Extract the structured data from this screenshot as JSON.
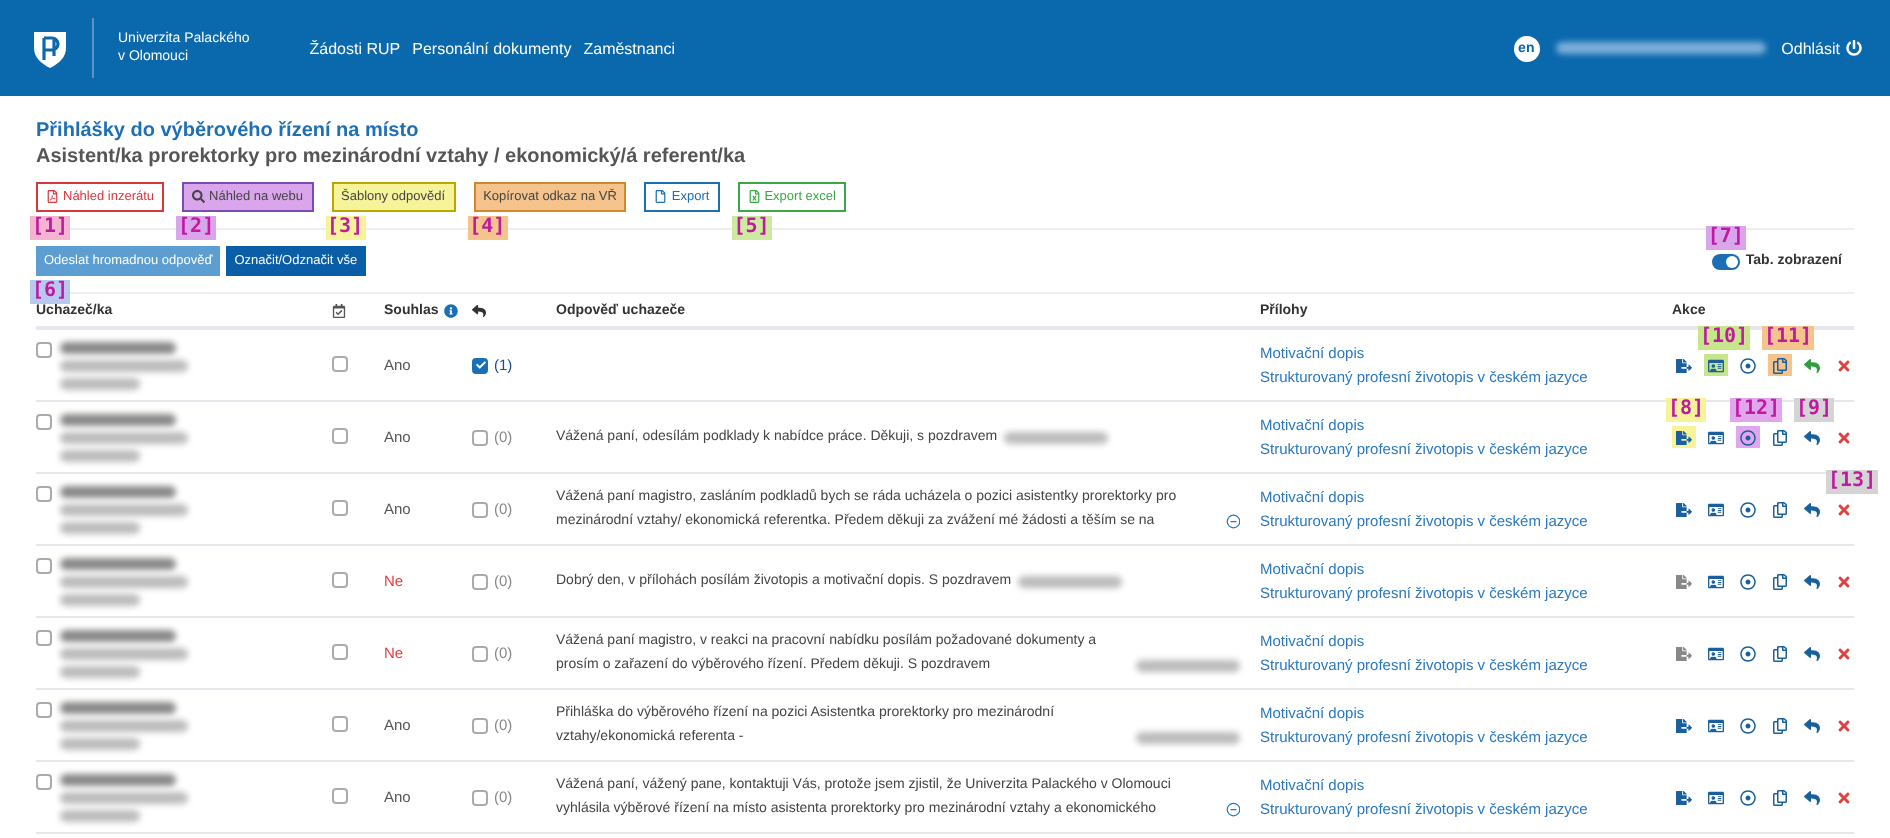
{
  "header": {
    "university": [
      "Univerzita Palackého",
      "v Olomouci"
    ],
    "nav": [
      "Žádosti RUP",
      "Personální dokumenty",
      "Zaměstnanci"
    ],
    "language": "en",
    "logout": "Odhlásit"
  },
  "title": "Přihlášky do výběrového řízení na místo",
  "subtitle": "Asistent/ka prorektorky pro mezinárodní vztahy / ekonomický/á referent/ka",
  "toolbar": [
    {
      "label": "Náhled inzerátu",
      "kind": "pdf",
      "color": "#d9363e",
      "callout": {
        "text": "[1]",
        "color": "#f3b5d0"
      }
    },
    {
      "label": "Náhled na webu",
      "kind": "search",
      "color": "#7b4bb5",
      "highlighted": true,
      "callout": {
        "text": "[2]",
        "color": "#d9a6ec"
      }
    },
    {
      "label": "Šablony odpovědí",
      "kind": "plain",
      "color": "#b9a800",
      "highlighted": true,
      "callout": {
        "text": "[3]",
        "color": "#f6f39a"
      }
    },
    {
      "label": "Kopírovat odkaz na VŘ",
      "kind": "plain",
      "color": "#d08a2c",
      "highlighted": true,
      "callout": {
        "text": "[4]",
        "color": "#f5c48c"
      }
    },
    {
      "label": "Export",
      "kind": "doc",
      "color": "#1a6fb5"
    },
    {
      "label": "Export excel",
      "kind": "excel",
      "color": "#3aa845",
      "callout": {
        "text": "[5]",
        "color": "#cdeaa0"
      }
    }
  ],
  "bulk": [
    {
      "label": "Odeslat hromadnou odpověď",
      "highlighted": true,
      "callout": {
        "text": "[6]",
        "color": "#b8c9f0"
      }
    },
    {
      "label": "Označit/Odznačit vše"
    }
  ],
  "toggle": {
    "label": "Tab. zobrazení",
    "on": true,
    "callout": {
      "text": "[7]",
      "color": "#d9a6ec"
    }
  },
  "columns": [
    "Uchazeč/ka",
    "Souhlas",
    "Odpověď uchazeče",
    "Přílohy",
    "Akce"
  ],
  "rows": [
    {
      "selected": false,
      "calendar": false,
      "consent": "Ano",
      "consent_ok": true,
      "replied": true,
      "count": "(1)",
      "actions": [
        {
          "kind": "export"
        },
        {
          "kind": "card",
          "highlighted": true,
          "callout": {
            "text": "[10]",
            "color": "#c7e58a"
          }
        },
        {
          "kind": "target"
        },
        {
          "kind": "copy",
          "highlighted": true,
          "callout": {
            "text": "[11]",
            "color": "#f5c48c"
          }
        },
        {
          "kind": "reply",
          "active": true
        },
        {
          "kind": "delete"
        }
      ],
      "attachments": [
        "Motivační dopis",
        "Strukturovaný profesní životopis v českém jazyce"
      ]
    },
    {
      "selected": false,
      "calendar": false,
      "consent": "Ano",
      "consent_ok": true,
      "replied": false,
      "count": "(0)",
      "response": "Vážená paní, odesílám podklady k nabídce práce. Děkuji, s pozdravem",
      "signature_redacted": true,
      "actions": [
        {
          "kind": "export",
          "highlighted": true,
          "callout": {
            "text": "[8]",
            "color": "#f6f39a"
          }
        },
        {
          "kind": "card"
        },
        {
          "kind": "target",
          "highlighted": true,
          "callout": {
            "text": "[12]",
            "color": "#e2a6ec"
          }
        },
        {
          "kind": "copy"
        },
        {
          "kind": "reply",
          "callout": {
            "text": "[9]",
            "color": "#d4d4d4"
          }
        },
        {
          "kind": "delete"
        }
      ],
      "attachments": [
        "Motivační dopis",
        "Strukturovaný profesní životopis v českém jazyce"
      ]
    },
    {
      "selected": false,
      "calendar": false,
      "consent": "Ano",
      "consent_ok": true,
      "replied": false,
      "count": "(0)",
      "response": "Vážená paní magistro, zasláním podkladů bych se ráda ucházela o pozici asistentky prorektorky pro mezinárodní vztahy/ ekonomická referentka. Předem děkuji za zvážení mé žádosti a těším se na",
      "expandable": true,
      "actions": [
        {
          "kind": "export"
        },
        {
          "kind": "card"
        },
        {
          "kind": "target"
        },
        {
          "kind": "copy"
        },
        {
          "kind": "reply"
        },
        {
          "kind": "delete",
          "callout": {
            "text": "[13]",
            "color": "#d4d4d4"
          }
        }
      ],
      "attachments": [
        "Motivační dopis",
        "Strukturovaný profesní životopis v českém jazyce"
      ]
    },
    {
      "selected": false,
      "calendar": false,
      "consent": "Ne",
      "consent_ok": false,
      "replied": false,
      "count": "(0)",
      "response": "Dobrý den, v přílohách posílám životopis a motivační dopis. S pozdravem",
      "signature_redacted": true,
      "actions": [
        {
          "kind": "export",
          "disabled": true
        },
        {
          "kind": "card"
        },
        {
          "kind": "target"
        },
        {
          "kind": "copy"
        },
        {
          "kind": "reply"
        },
        {
          "kind": "delete"
        }
      ],
      "attachments": [
        "Motivační dopis",
        "Strukturovaný profesní životopis v českém jazyce"
      ]
    },
    {
      "selected": false,
      "calendar": false,
      "consent": "Ne",
      "consent_ok": false,
      "replied": false,
      "count": "(0)",
      "response": "Vážená paní magistro, v reakci na pracovní nabídku posílám požadované dokumenty a prosím o zařazení do výběrového řízení. Předem děkuji. S pozdravem",
      "signature_redacted": true,
      "actions": [
        {
          "kind": "export",
          "disabled": true
        },
        {
          "kind": "card"
        },
        {
          "kind": "target"
        },
        {
          "kind": "copy"
        },
        {
          "kind": "reply"
        },
        {
          "kind": "delete"
        }
      ],
      "attachments": [
        "Motivační dopis",
        "Strukturovaný profesní životopis v českém jazyce"
      ]
    },
    {
      "selected": false,
      "calendar": false,
      "consent": "Ano",
      "consent_ok": true,
      "replied": false,
      "count": "(0)",
      "response": "Přihláška do výběrového řízení na pozici Asistentka prorektorky pro mezinárodní vztahy/ekonomická referenta -",
      "signature_redacted": true,
      "actions": [
        {
          "kind": "export"
        },
        {
          "kind": "card"
        },
        {
          "kind": "target"
        },
        {
          "kind": "copy"
        },
        {
          "kind": "reply"
        },
        {
          "kind": "delete"
        }
      ],
      "attachments": [
        "Motivační dopis",
        "Strukturovaný profesní životopis v českém jazyce"
      ]
    },
    {
      "selected": false,
      "calendar": false,
      "consent": "Ano",
      "consent_ok": true,
      "replied": false,
      "count": "(0)",
      "response": "Vážená paní, vážený pane, kontaktuji Vás, protože jsem zjistil, že Univerzita Palackého v Olomouci vyhlásila výběrové řízení na místo asistenta prorektorky pro mezinárodní vztahy a ekonomického",
      "expandable": true,
      "actions": [
        {
          "kind": "export"
        },
        {
          "kind": "card"
        },
        {
          "kind": "target"
        },
        {
          "kind": "copy"
        },
        {
          "kind": "reply"
        },
        {
          "kind": "delete"
        }
      ],
      "attachments": [
        "Motivační dopis",
        "Strukturovaný profesní životopis v českém jazyce"
      ]
    }
  ]
}
